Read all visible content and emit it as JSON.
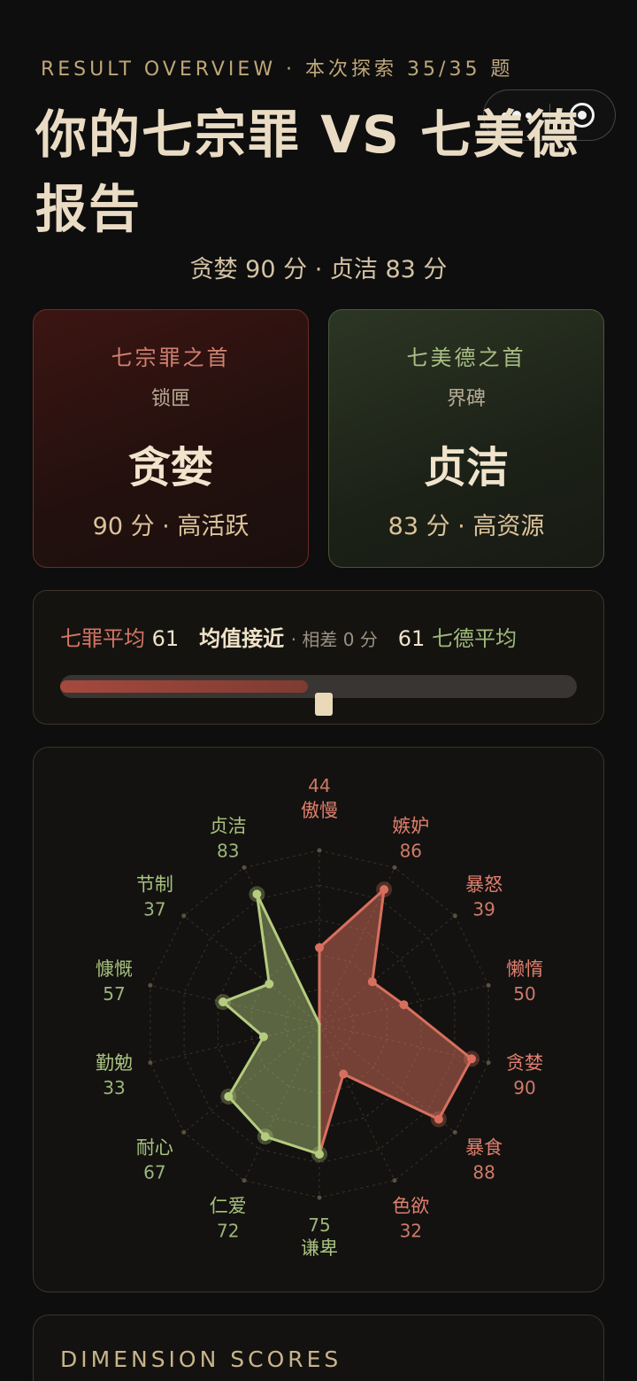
{
  "header": {
    "eyebrow": "RESULT OVERVIEW · 本次探索 35/35 题",
    "title": "你的七宗罪 VS 七美德报告",
    "subtitle": "贪婪 90 分 · 贞洁 83 分"
  },
  "cards": {
    "sin": {
      "heading": "七宗罪之首",
      "sub": "锁匣",
      "name": "贪婪",
      "meta": "90 分 · 高活跃"
    },
    "virtue": {
      "heading": "七美德之首",
      "sub": "界碑",
      "name": "贞洁",
      "meta": "83 分 · 高资源"
    }
  },
  "comparison": {
    "sin_label": "七罪平均",
    "sin_avg": "61",
    "verdict": "均值接近",
    "diff": "· 相差 0 分",
    "virtue_avg": "61",
    "virtue_label": "七德平均",
    "sin_fill_pct": 48,
    "marker_pct": 51
  },
  "radar": {
    "max": 100,
    "sins": [
      {
        "name": "傲慢",
        "value": 44
      },
      {
        "name": "嫉妒",
        "value": 86
      },
      {
        "name": "暴怒",
        "value": 39
      },
      {
        "name": "懒惰",
        "value": 50
      },
      {
        "name": "贪婪",
        "value": 90
      },
      {
        "name": "暴食",
        "value": 88
      },
      {
        "name": "色欲",
        "value": 32
      }
    ],
    "virtues": [
      {
        "name": "谦卑",
        "value": 75
      },
      {
        "name": "仁爱",
        "value": 72
      },
      {
        "name": "耐心",
        "value": 67
      },
      {
        "name": "勤勉",
        "value": 33
      },
      {
        "name": "慷慨",
        "value": 57
      },
      {
        "name": "节制",
        "value": 37
      },
      {
        "name": "贞洁",
        "value": 83
      }
    ],
    "colors": {
      "sin": "#d86f5e",
      "virtue": "#b5cc7f"
    }
  },
  "dimensions": {
    "title": "DIMENSION SCORES"
  }
}
